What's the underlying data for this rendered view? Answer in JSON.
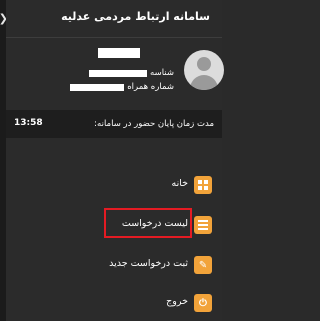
{
  "header": {
    "title": "سامانه ارتباط مردمی عدلیه",
    "collapse_icon": "chevron-left-icon"
  },
  "profile": {
    "avatar_icon": "user-avatar-icon",
    "id_label": "شناسه",
    "phone_label": "شماره همراه"
  },
  "session": {
    "label": "مدت زمان پایان حضور در سامانه:",
    "time": "13:58"
  },
  "menu": [
    {
      "label": "خانه",
      "icon": "home-grid-icon"
    },
    {
      "label": "لیست درخواست",
      "icon": "list-icon"
    },
    {
      "label": "ثبت درخواست جدید",
      "icon": "edit-icon"
    },
    {
      "label": "خروج",
      "icon": "power-icon"
    }
  ],
  "colors": {
    "background": "#2b2b2b",
    "icon_accent": "#f2a33a",
    "highlight": "#e41b23"
  }
}
